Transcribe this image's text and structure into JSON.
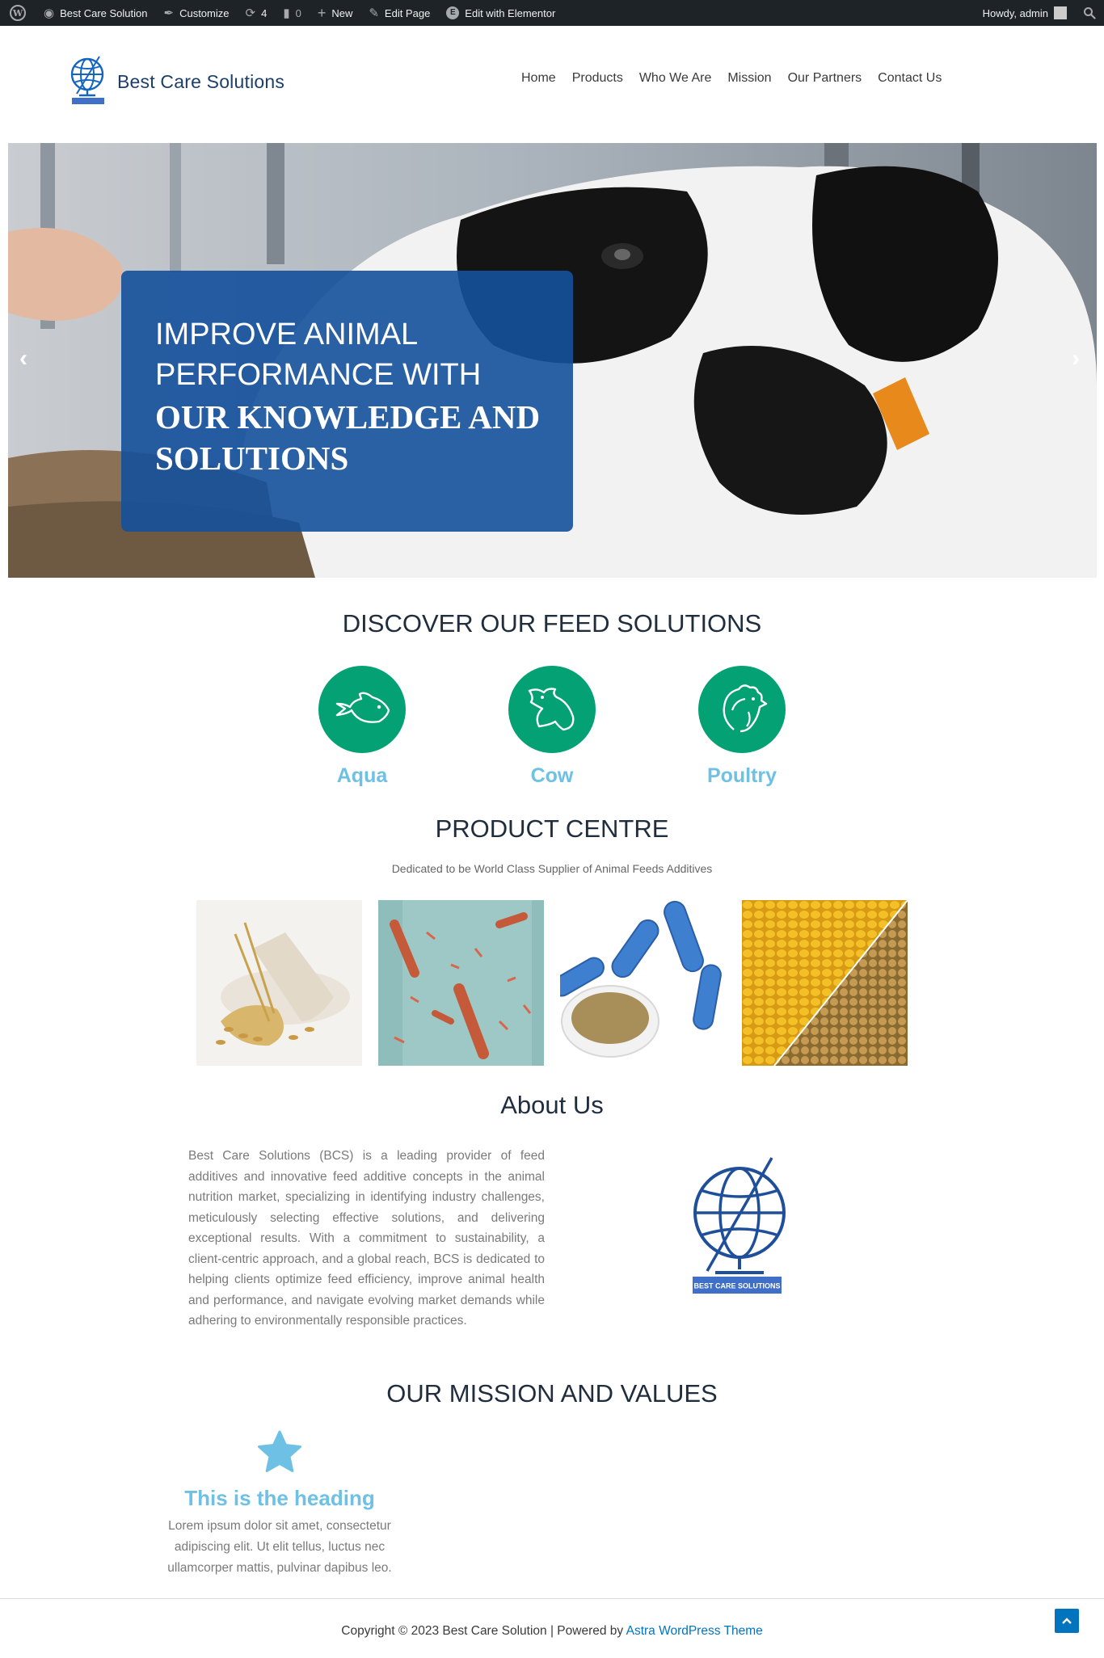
{
  "admin_bar": {
    "site_name": "Best Care Solution",
    "customize": "Customize",
    "updates_count": "4",
    "comments_count": "0",
    "new": "New",
    "edit_page": "Edit Page",
    "edit_elementor": "Edit with Elementor",
    "howdy": "Howdy, admin"
  },
  "header": {
    "site_title": "Best Care Solutions",
    "nav": [
      "Home",
      "Products",
      "Who We Are",
      "Mission",
      "Our Partners",
      "Contact Us"
    ]
  },
  "hero": {
    "lines": [
      "IMPROVE ANIMAL",
      "PERFORMANCE WITH",
      "OUR KNOWLEDGE AND",
      "SOLUTIONS"
    ],
    "prev_arrow": "‹",
    "next_arrow": "›"
  },
  "feed": {
    "heading": "DISCOVER OUR FEED SOLUTIONS",
    "items": [
      {
        "label": "Aqua",
        "icon": "fish-icon"
      },
      {
        "label": "Cow",
        "icon": "cow-icon"
      },
      {
        "label": "Poultry",
        "icon": "chicken-icon"
      }
    ]
  },
  "products": {
    "heading": "PRODUCT CENTRE",
    "subtitle": "Dedicated to be World Class Supplier of Animal Feeds Additives"
  },
  "about": {
    "heading": "About Us",
    "text": "Best Care Solutions (BCS) is a leading provider of feed additives and innovative feed additive concepts in the animal nutrition market, specializing in identifying industry challenges, meticulously selecting effective solutions, and delivering exceptional results. With a commitment to sustainability, a client-centric approach, and a global reach, BCS is dedicated to helping clients optimize feed efficiency, improve animal health and performance, and navigate evolving market demands while adhering to environmentally responsible practices.",
    "logo_caption": "BEST CARE SOLUTIONS"
  },
  "mission": {
    "heading": "OUR MISSION AND VALUES",
    "item_heading": "This is the heading",
    "item_text": "Lorem ipsum dolor sit amet, consectetur adipiscing elit. Ut elit tellus, luctus nec ullamcorper mattis, pulvinar dapibus leo."
  },
  "footer": {
    "copyright": "Copyright © 2023 Best Care Solution | Powered by ",
    "theme_link": "Astra WordPress Theme"
  },
  "colors": {
    "admin_bar": "#1d2327",
    "brand_blue": "#1c3f6b",
    "hero_box": "#14509b",
    "feed_green": "#03a173",
    "accent_light_blue": "#6ec1e4",
    "link_blue": "#0274be"
  }
}
